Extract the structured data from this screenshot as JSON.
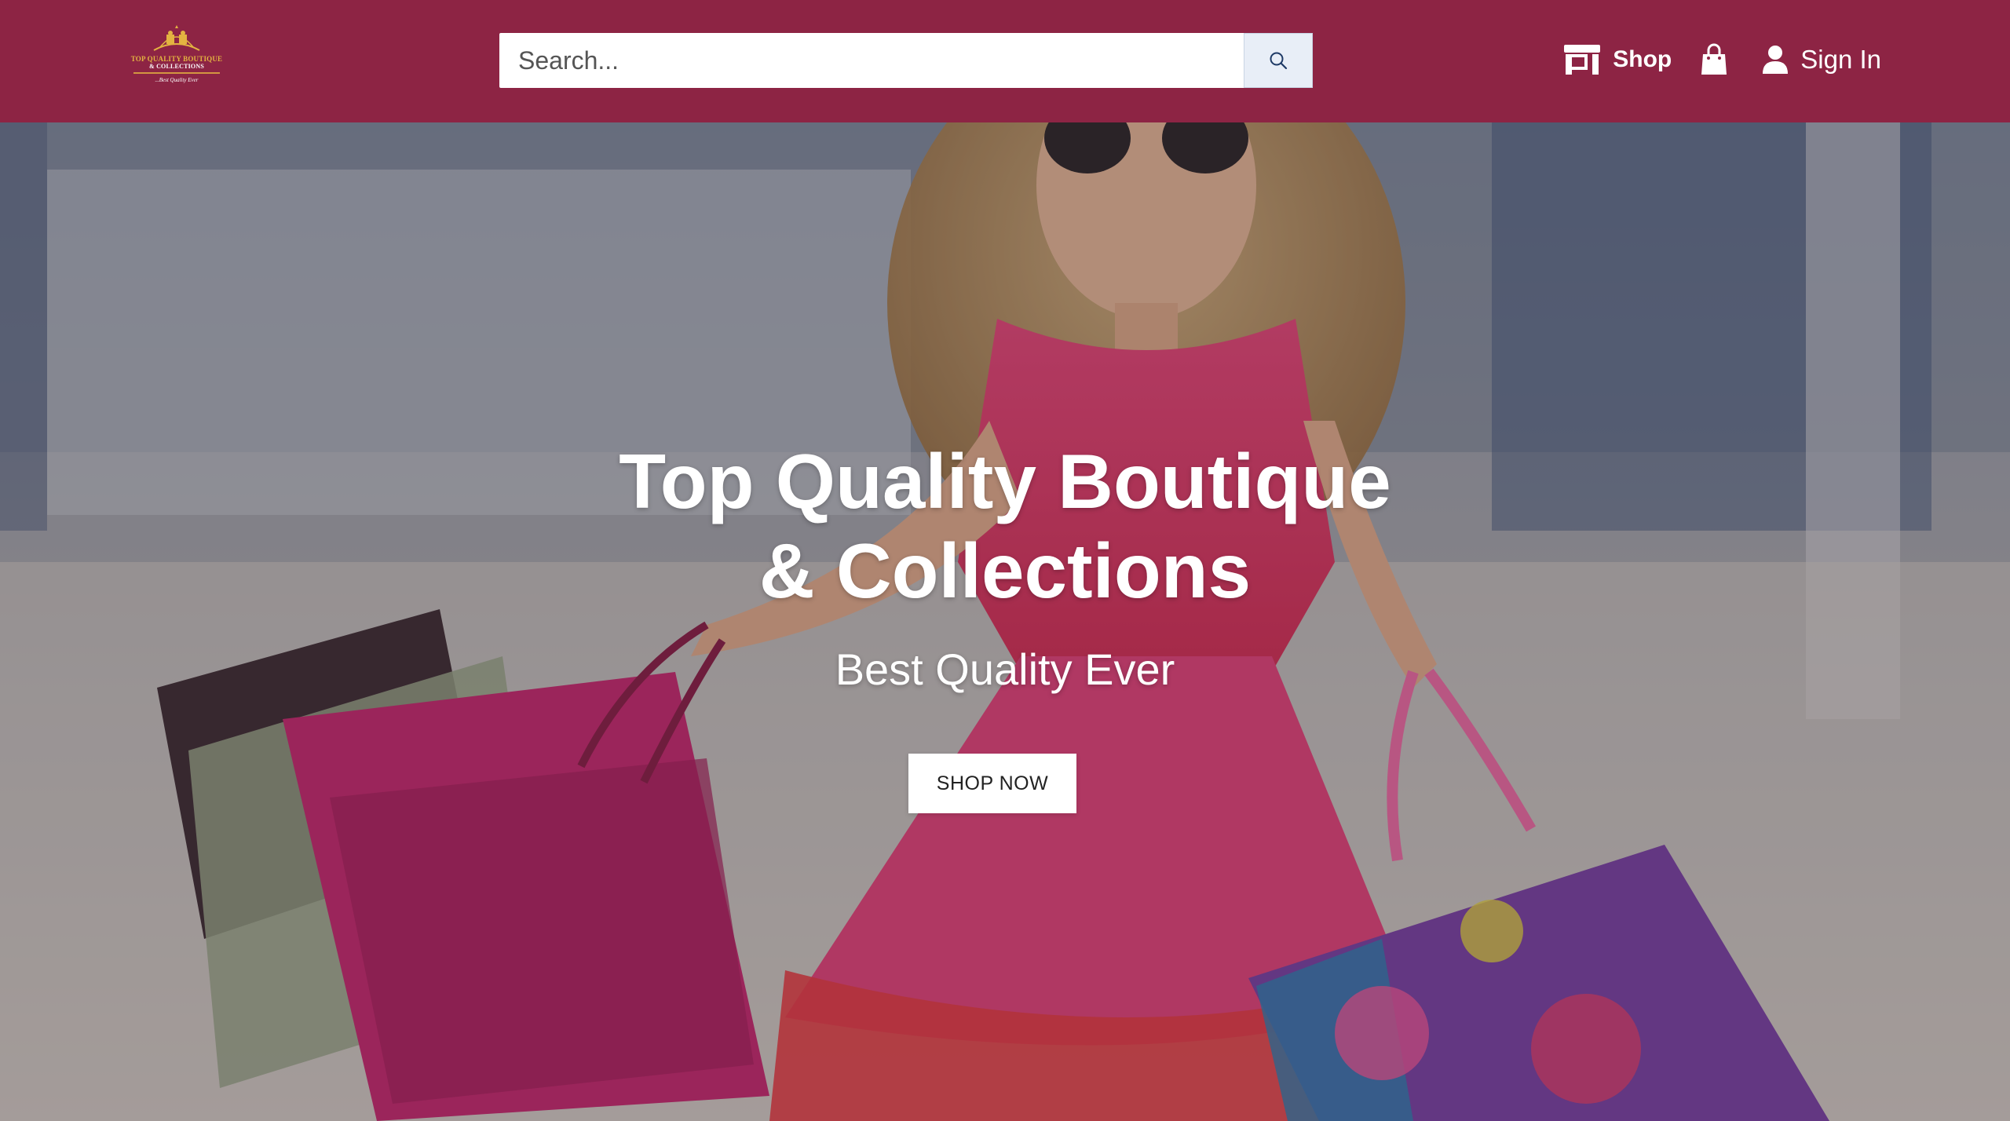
{
  "colors": {
    "navbar": "#8d2444",
    "logo_gold": "#e3b341",
    "search_button_bg": "#e8eef7",
    "dress_pink": "#e23c6e"
  },
  "logo": {
    "line1": "TOP QUALITY BOUTIQUE",
    "line2": "& COLLECTIONS",
    "tagline": "...Best Quality Ever"
  },
  "search": {
    "placeholder": "Search...",
    "button_icon": "search-icon"
  },
  "nav": {
    "shop_icon": "storefront-icon",
    "shop_label": "Shop",
    "bag_icon": "shopping-bag-icon",
    "user_icon": "user-icon",
    "signin_label": "Sign In"
  },
  "hero": {
    "title_line1": "Top Quality Boutique",
    "title_line2": "& Collections",
    "subtitle": "Best Quality Ever",
    "cta_label": "SHOP NOW"
  }
}
